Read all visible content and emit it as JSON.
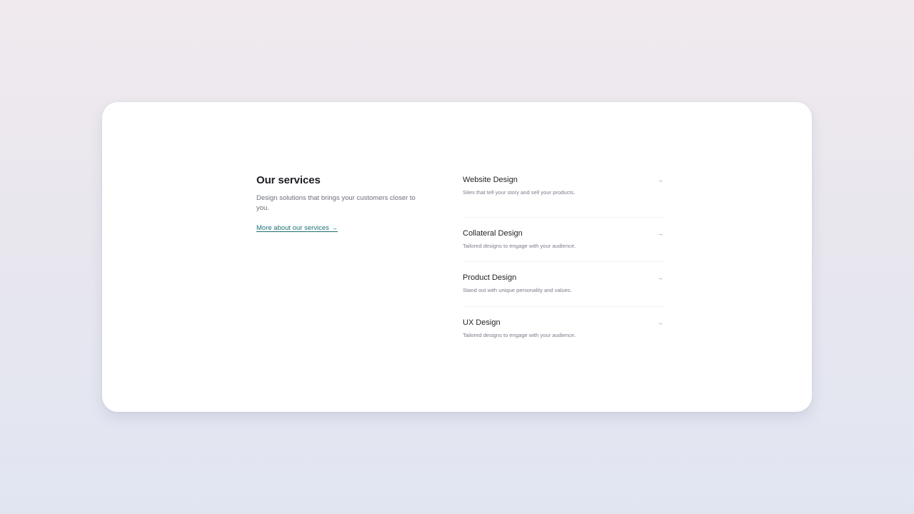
{
  "intro": {
    "title": "Our services",
    "description": "Design solutions that brings your customers closer to you.",
    "link_label": "More about our services →"
  },
  "services": [
    {
      "title": "Website Design",
      "description": "Sites that tell your story and sell your products.",
      "arrow": "→"
    },
    {
      "title": "Collateral Design",
      "description": "Tailored designs to engage with your audience.",
      "arrow": "→"
    },
    {
      "title": "Product Design",
      "description": "Stand out with unique personality and values.",
      "arrow": "→"
    },
    {
      "title": "UX Design",
      "description": "Tailored designs to engage with your audience.",
      "arrow": "→"
    }
  ],
  "colors": {
    "accent": "#1f6f72",
    "card": "#ffffff",
    "text": "#1c1d21",
    "muted": "#6b6f7a"
  }
}
